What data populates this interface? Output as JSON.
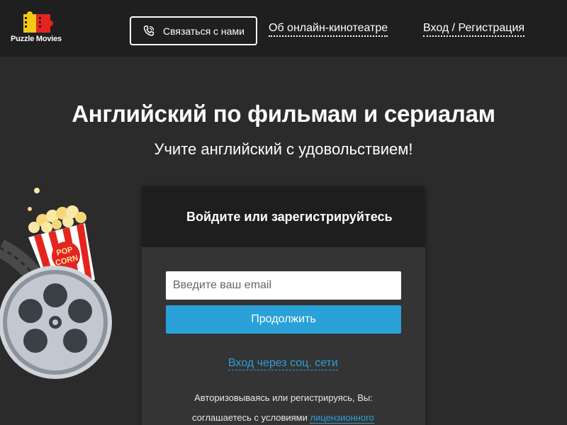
{
  "header": {
    "logo_text": "Puzzle Movies",
    "contact_label": "Связаться с нами",
    "about_label": "Об онлайн-кинотеатре",
    "login_label": "Вход / Регистрация"
  },
  "hero": {
    "title": "Английский по фильмам и сериалам",
    "subtitle": "Учите английский с удовольствием!"
  },
  "illustration": {
    "popcorn_text_1": "POP",
    "popcorn_text_2": "CORN"
  },
  "auth": {
    "title": "Войдите или зарегистрируйтесь",
    "email_placeholder": "Введите ваш email",
    "email_value": "",
    "continue_label": "Продолжить",
    "social_label": "Вход через соц. сети",
    "terms_line1": "Авторизовываясь или регистрируясь, Вы:",
    "terms_line2_prefix": "соглашаетесь с условиями ",
    "terms_link": "лицензионного"
  },
  "colors": {
    "accent": "#2aa1d9",
    "background": "#2b2b2b",
    "header": "#1f1f1f",
    "panel": "#343434",
    "panel_head": "#1e1e1e"
  },
  "icons": {
    "logo": "puzzle-film-logo-icon",
    "contact": "phone-icon"
  }
}
